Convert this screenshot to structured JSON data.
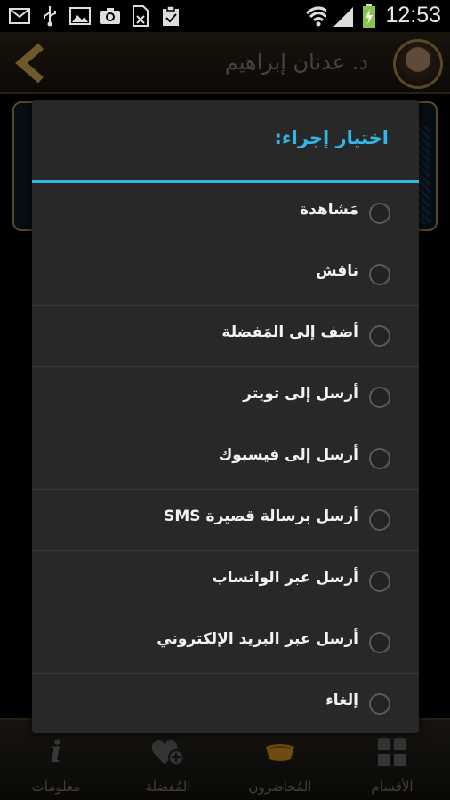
{
  "status_bar": {
    "time": "12:53",
    "left_icons": [
      "mail-icon",
      "usb-icon",
      "gallery-icon",
      "camera-icon",
      "file-icon",
      "clipboard-icon"
    ],
    "right_icons": [
      "wifi-icon",
      "signal-icon",
      "battery-charging-icon"
    ]
  },
  "header": {
    "title": "د. عدنان إبراهيم",
    "back_icon": "chevron-left-icon"
  },
  "dialog": {
    "title": "اختيار إجراء:",
    "accent_color": "#33b5e5",
    "options": [
      {
        "label": "مَشاهدة"
      },
      {
        "label": "ناقش"
      },
      {
        "label": "أضف إلى المَفضلة"
      },
      {
        "label": "أرسل إلى تويتر"
      },
      {
        "label": "أرسل إلى فيسبوك"
      },
      {
        "label": "أرسل برسالة  قصيرة SMS"
      },
      {
        "label": "أرسل عبر  الواتساب"
      },
      {
        "label": "أرسل عبر البريد الإلكتروني"
      },
      {
        "label": "إلغاء"
      }
    ]
  },
  "bottom_nav": {
    "items": [
      {
        "label": "معلومات",
        "icon": "info-icon"
      },
      {
        "label": "المُفضلة",
        "icon": "favorite-add-icon"
      },
      {
        "label": "المُحاضرون",
        "icon": "lecturers-icon"
      },
      {
        "label": "الأقسام",
        "icon": "grid-icon"
      }
    ]
  },
  "colors": {
    "gold_border": "#a5843f",
    "dialog_bg": "#282828"
  }
}
